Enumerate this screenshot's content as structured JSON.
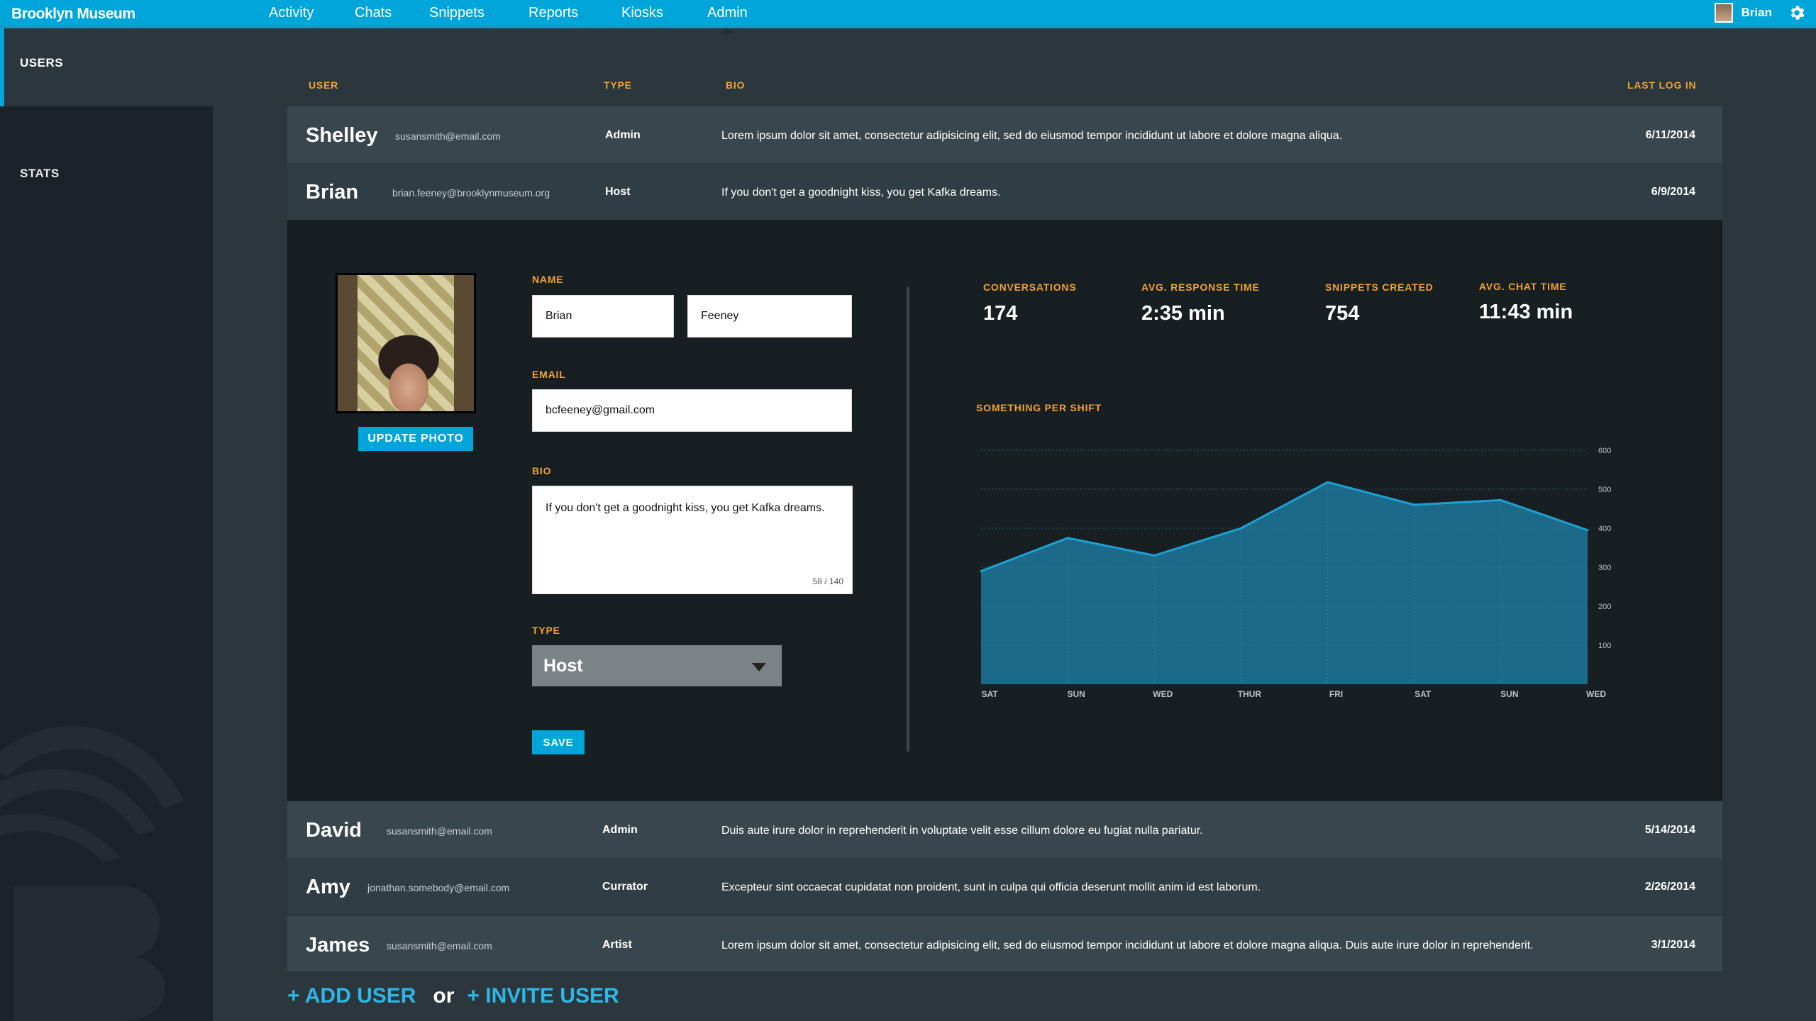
{
  "app": {
    "brand": "Brooklyn Museum",
    "nav": [
      "Activity",
      "Chats",
      "Snippets",
      "Reports",
      "Kiosks",
      "Admin"
    ],
    "active_nav": "Admin",
    "user_name": "Brian"
  },
  "sidebar": {
    "items": [
      {
        "label": "USERS",
        "active": true
      },
      {
        "label": "STATS",
        "active": false
      }
    ]
  },
  "table": {
    "headers": {
      "user": "USER",
      "type": "TYPE",
      "bio": "BIO",
      "last_login": "LAST LOG IN"
    },
    "rows": [
      {
        "name": "Shelley",
        "email": "susansmith@email.com",
        "type": "Admin",
        "bio": "Lorem ipsum dolor sit amet, consectetur adipisicing elit, sed do eiusmod tempor incididunt ut labore et dolore magna aliqua.",
        "date": "6/11/2014"
      },
      {
        "name": "Brian",
        "email": "brian.feeney@brooklynmuseum.org",
        "type": "Host",
        "bio": "If you don't get a goodnight kiss, you get Kafka dreams.",
        "date": "6/9/2014"
      },
      {
        "name": "David",
        "email": "susansmith@email.com",
        "type": "Admin",
        "bio": "Duis aute irure dolor in reprehenderit in voluptate velit esse cillum dolore eu fugiat nulla pariatur.",
        "date": "5/14/2014"
      },
      {
        "name": "Amy",
        "email": "jonathan.somebody@email.com",
        "type": "Currator",
        "bio": "Excepteur sint occaecat cupidatat non proident, sunt in culpa qui officia deserunt mollit anim id est laborum.",
        "date": "2/26/2014"
      },
      {
        "name": "James",
        "email": "susansmith@email.com",
        "type": "Artist",
        "bio": "Lorem ipsum dolor sit amet, consectetur adipisicing elit, sed do eiusmod tempor incididunt ut labore et dolore magna aliqua. Duis aute irure dolor in reprehenderit.",
        "date": "3/1/2014"
      }
    ]
  },
  "detail": {
    "update_photo": "UPDATE PHOTO",
    "name_label": "NAME",
    "first_name": "Brian",
    "last_name": "Feeney",
    "email_label": "EMAIL",
    "email": "bcfeeney@gmail.com",
    "bio_label": "BIO",
    "bio": "If you don't get a goodnight kiss, you get Kafka dreams.",
    "bio_count": "58 / 140",
    "type_label": "TYPE",
    "type_value": "Host",
    "save": "SAVE",
    "stats": [
      {
        "label": "CONVERSATIONS",
        "value": "174"
      },
      {
        "label": "AVG. RESPONSE TIME",
        "value": "2:35 min"
      },
      {
        "label": "SNIPPETS CREATED",
        "value": "754"
      },
      {
        "label": "AVG. CHAT TIME",
        "value": "11:43 min"
      }
    ]
  },
  "chart_data": {
    "type": "area",
    "title": "SOMETHING PER SHIFT",
    "categories": [
      "SAT",
      "SUN",
      "WED",
      "THUR",
      "FRI",
      "SAT",
      "SUN",
      "WED"
    ],
    "values": [
      290,
      375,
      330,
      400,
      518,
      460,
      472,
      395
    ],
    "yticks": [
      100,
      200,
      300,
      400,
      500,
      600
    ],
    "ylim": [
      0,
      600
    ],
    "grid": true,
    "color": "#1ea0d2",
    "fill": "#1c6a8a"
  },
  "footer": {
    "add_user": "+ ADD USER",
    "or": "or",
    "invite_user": "+ INVITE USER"
  },
  "colors": {
    "accent": "#00a6d9",
    "label": "#f0a330"
  }
}
